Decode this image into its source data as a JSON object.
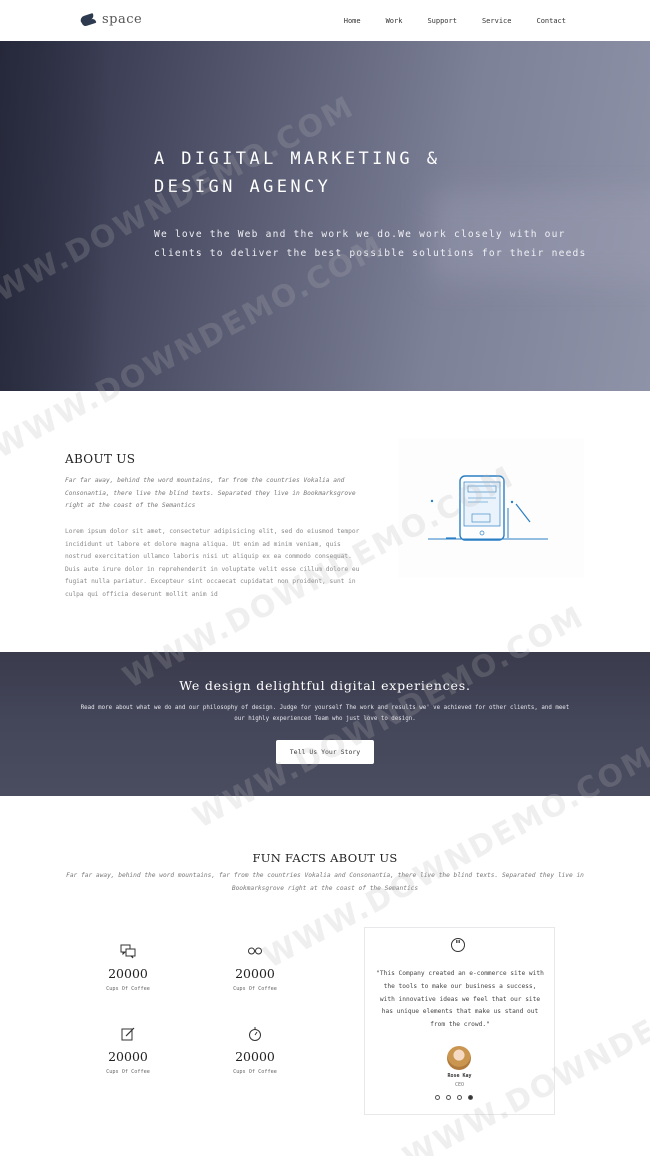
{
  "nav": {
    "logo_text": "space",
    "items": [
      {
        "label": "Home"
      },
      {
        "label": "Work"
      },
      {
        "label": "Support"
      },
      {
        "label": "Service"
      },
      {
        "label": "Contact"
      }
    ]
  },
  "hero": {
    "title_line1": "A DIGITAL MARKETING &",
    "title_line2": "DESIGN AGENCY",
    "subtitle_line1": "We love the Web and the work we do.We work closely with our",
    "subtitle_line2": "clients to deliver the best possible solutions for their needs"
  },
  "about": {
    "title": "ABOUT US",
    "intro": "Far far away, behind the word mountains, far from the countries Vokalia and Consonantia, there live the blind texts. Separated they live in Bookmarksgrove right at the coast of the Semantics",
    "body": "Lorem ipsum dolor sit amet, consectetur adipisicing elit, sed do eiusmod tempor incididunt ut labore et dolore magna aliqua. Ut enim ad minim veniam, quis nostrud exercitation ullamco laboris nisi ut aliquip ex ea commodo consequat. Duis aute irure dolor in reprehenderit in voluptate velit esse cillum dolore eu fugiat nulla pariatur. Excepteur sint occaecat cupidatat non proident, sunt in culpa qui officia deserunt mollit anim id"
  },
  "design_band": {
    "title": "We design delightful digital experiences.",
    "text": "Read more about what we do and our philosophy of design. Judge for yourself The work and results we' ve achieved for other clients, and meet our highly experienced Team who just love to design.",
    "button_label": "Tell Us Your Story"
  },
  "fun_facts": {
    "title": "FUN FACTS ABOUT US",
    "subtitle": "Far far away, behind the word mountains, far from the countries Vokalia and Consonantia, there live the blind texts. Separated they live in Bookmarksgrove right at the coast of the Semantics",
    "facts": [
      {
        "number": "20000",
        "label": "Cups Of Coffee",
        "icon": "chat-bubbles-icon"
      },
      {
        "number": "20000",
        "label": "Cups Of Coffee",
        "icon": "glasses-icon"
      },
      {
        "number": "20000",
        "label": "Cups Of Coffee",
        "icon": "edit-icon"
      },
      {
        "number": "20000",
        "label": "Cups Of Coffee",
        "icon": "stopwatch-icon"
      }
    ]
  },
  "testimonial": {
    "quote": "\"This Company created an e-commerce site with the tools to make our business a success, with innovative ideas we feel that our site has unique elements that make us stand out from the crowd.\"",
    "name": "Rose Kay",
    "role": "CEO",
    "active_slide": 4,
    "slide_count": 4
  },
  "watermark": "WWW.DOWNDEMO.COM"
}
